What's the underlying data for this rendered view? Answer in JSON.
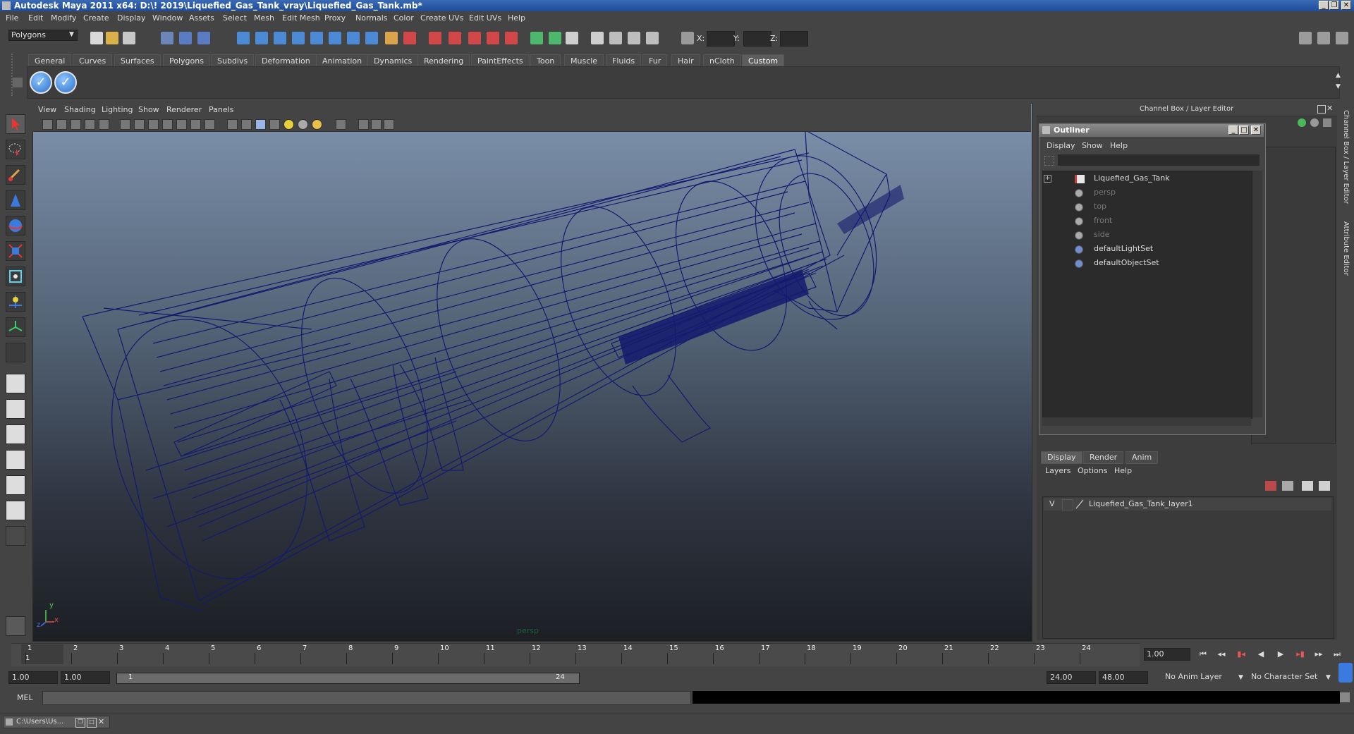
{
  "window": {
    "title": "Autodesk Maya 2011 x64: D:\\! 2019\\Liquefied_Gas_Tank_vray\\Liquefied_Gas_Tank.mb*",
    "controls": [
      "minimize-icon",
      "restore-icon",
      "close-icon"
    ]
  },
  "menubar": [
    "File",
    "Edit",
    "Modify",
    "Create",
    "Display",
    "Window",
    "Assets",
    "Select",
    "Mesh",
    "Edit Mesh",
    "Proxy",
    "Normals",
    "Color",
    "Create UVs",
    "Edit UVs",
    "Help"
  ],
  "statusline": {
    "menu_set": "Polygons",
    "x_label": "X:",
    "y_label": "Y:",
    "z_label": "Z:"
  },
  "shelf": {
    "tabs": [
      "General",
      "Curves",
      "Surfaces",
      "Polygons",
      "Subdivs",
      "Deformation",
      "Animation",
      "Dynamics",
      "Rendering",
      "PaintEffects",
      "Toon",
      "Muscle",
      "Fluids",
      "Fur",
      "Hair",
      "nCloth",
      "Custom"
    ],
    "active_tab": "Custom",
    "buttons": [
      "checkmark-icon",
      "checkmark-icon"
    ]
  },
  "viewport": {
    "menu": [
      "View",
      "Shading",
      "Lighting",
      "Show",
      "Renderer",
      "Panels"
    ],
    "camera_label": "persp",
    "axis_y": "y",
    "axis_x": "x",
    "axis_z": "z",
    "wire_color": "#141a6e"
  },
  "channelbox": {
    "title": "Channel Box / Layer Editor",
    "side_tabs": [
      "Channel Box / Layer Editor",
      "Attribute Editor"
    ]
  },
  "outliner": {
    "title": "Outliner",
    "menu": [
      "Display",
      "Show",
      "Help"
    ],
    "items": [
      {
        "label": "Liquefied_Gas_Tank",
        "dim": false,
        "icon": "transform-icon"
      },
      {
        "label": "persp",
        "dim": true,
        "icon": "camera-icon"
      },
      {
        "label": "top",
        "dim": true,
        "icon": "camera-icon"
      },
      {
        "label": "front",
        "dim": true,
        "icon": "camera-icon"
      },
      {
        "label": "side",
        "dim": true,
        "icon": "camera-icon"
      },
      {
        "label": "defaultLightSet",
        "dim": false,
        "icon": "set-icon"
      },
      {
        "label": "defaultObjectSet",
        "dim": false,
        "icon": "set-icon"
      }
    ]
  },
  "layers": {
    "tabs": [
      "Display",
      "Render",
      "Anim"
    ],
    "active_tab": "Display",
    "menu": [
      "Layers",
      "Options",
      "Help"
    ],
    "rows": [
      {
        "visible": "V",
        "name": "Liquefied_Gas_Tank_layer1"
      }
    ]
  },
  "timeline": {
    "ticks": [
      "1",
      "2",
      "3",
      "4",
      "5",
      "6",
      "7",
      "8",
      "9",
      "10",
      "11",
      "12",
      "13",
      "14",
      "15",
      "16",
      "17",
      "18",
      "19",
      "20",
      "21",
      "22",
      "23",
      "24"
    ],
    "current_frame": "1.00",
    "current_marker": "1"
  },
  "range": {
    "start_time": "1.00",
    "playback_start": "1.00",
    "slider_start": "1",
    "slider_end": "24",
    "playback_end": "24.00",
    "end_time": "48.00",
    "anim_layer": "No Anim Layer",
    "character_set": "No Character Set"
  },
  "command": {
    "label": "MEL"
  },
  "taskbar": {
    "item": "C:\\Users\\Us..."
  }
}
